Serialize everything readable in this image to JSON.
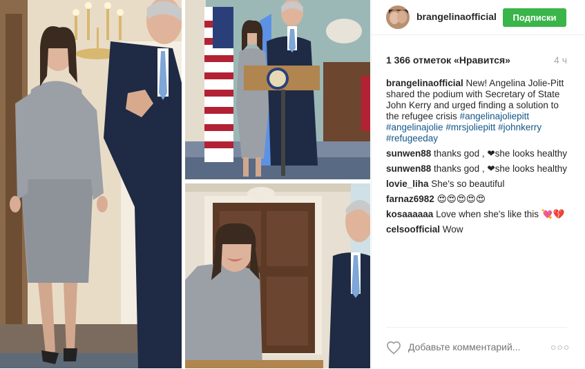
{
  "header": {
    "username": "brangelinaofficial",
    "follow_label": "Подписки"
  },
  "stats": {
    "likes": "1 366 отметок «Нравится»",
    "time": "4 ч"
  },
  "caption": {
    "user": "brangelinaofficial",
    "text": "New! Angelina Jolie-Pitt shared the podium with Secretary of State John Kerry and urged finding a solution to the refugee crisis",
    "hashtags": "#angelinajoliepitt #angelinajolie #mrsjoliepitt #johnkerry #refugeeday"
  },
  "comments": [
    {
      "user": "sunwen88",
      "text": "thanks god , ❤she looks healthy"
    },
    {
      "user": "sunwen88",
      "text": "thanks god , ❤she looks healthy"
    },
    {
      "user": "lovie_liha",
      "text": "She's so beautiful"
    },
    {
      "user": "farnaz6982",
      "text": "😍😍😍😍😍"
    },
    {
      "user": "kosaaaaaa",
      "text": "Love when she's like this 💘💔"
    },
    {
      "user": "celsoofficial",
      "text": "Wow"
    }
  ],
  "footer": {
    "comment_placeholder": "Добавьте комментарий...",
    "more_label": "○○○"
  },
  "icons": {
    "like": "heart-icon",
    "options": "more-options-icon"
  },
  "colors": {
    "follow_button": "#3ab54a",
    "hashtag": "#125688",
    "muted": "#a5a7aa"
  }
}
